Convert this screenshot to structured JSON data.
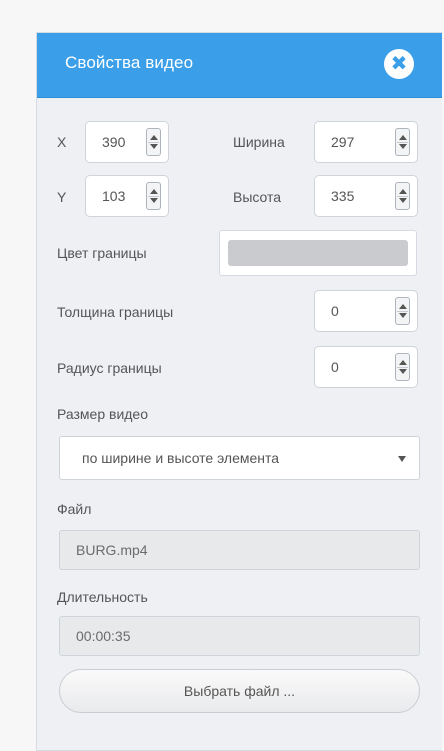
{
  "panel": {
    "title": "Свойства видео",
    "close_icon": "close-icon"
  },
  "position": {
    "x_label": "X",
    "x_value": "390",
    "y_label": "Y",
    "y_value": "103",
    "width_label": "Ширина",
    "width_value": "297",
    "height_label": "Высота",
    "height_value": "335"
  },
  "border": {
    "color_label": "Цвет границы",
    "color_value": "#c9cbcf",
    "thickness_label": "Толщина границы",
    "thickness_value": "0",
    "radius_label": "Радиус границы",
    "radius_value": "0"
  },
  "video_size": {
    "label": "Размер видео",
    "selected": "по ширине и высоте элемента"
  },
  "file": {
    "label": "Файл",
    "value": "BURG.mp4"
  },
  "duration": {
    "label": "Длительность",
    "value": "00:00:35"
  },
  "choose_file_button": "Выбрать файл ..."
}
